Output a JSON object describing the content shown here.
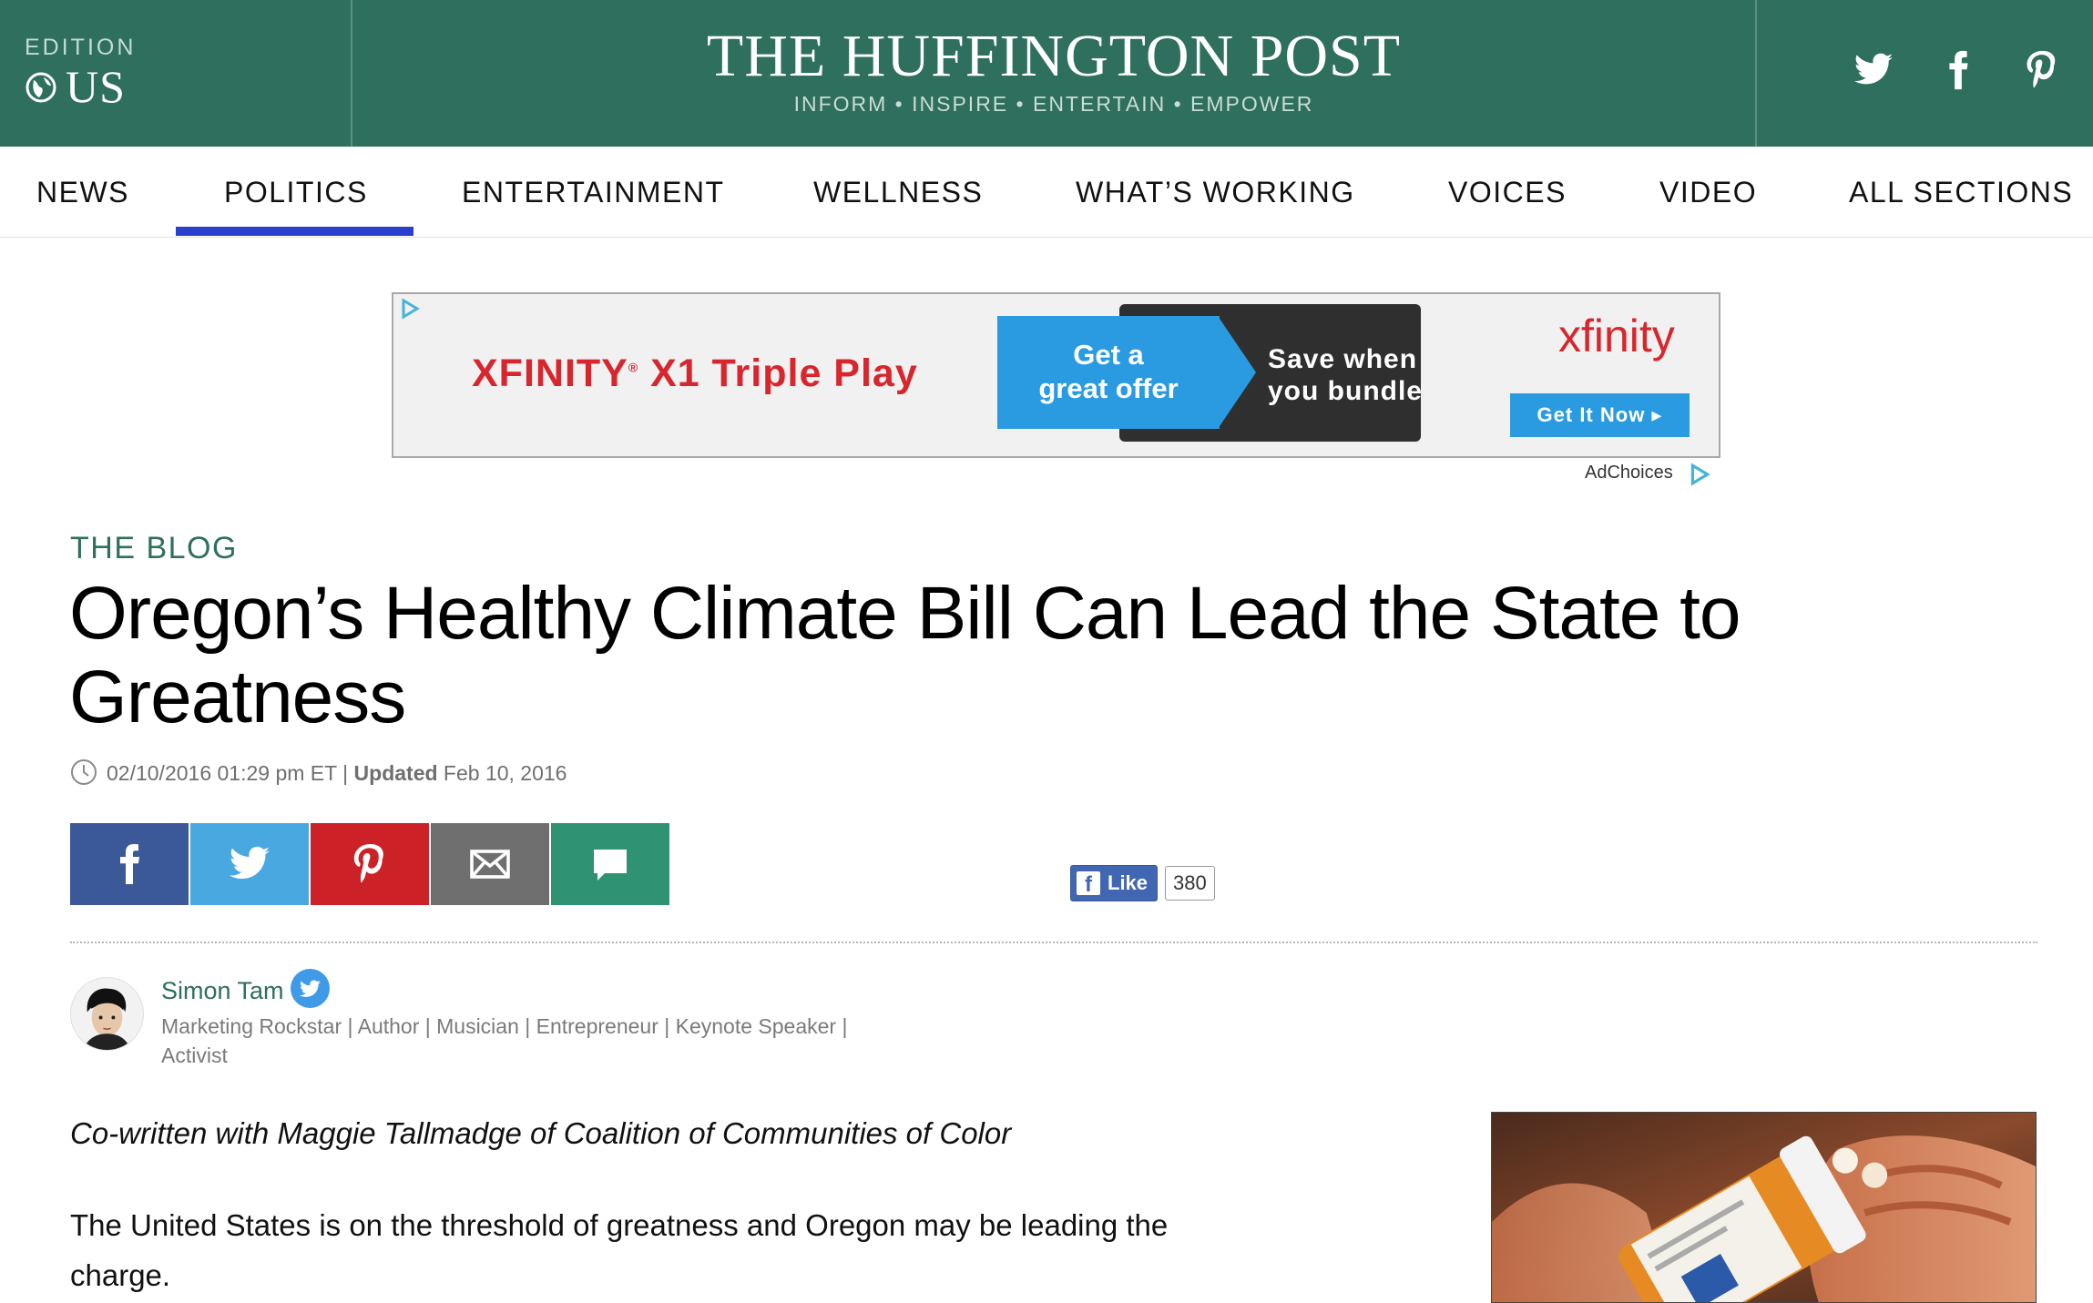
{
  "masthead": {
    "edition_label": "EDITION",
    "edition_value": "US",
    "logo": "THE HUFFINGTON POST",
    "tagline": "INFORM • INSPIRE • ENTERTAIN • EMPOWER",
    "background": "#2e6f5d"
  },
  "nav": {
    "items": [
      "NEWS",
      "POLITICS",
      "ENTERTAINMENT",
      "WELLNESS",
      "WHAT’S WORKING",
      "VOICES",
      "VIDEO",
      "ALL SECTIONS"
    ],
    "active": "POLITICS",
    "active_color": "#2a3fcb"
  },
  "ad": {
    "headline_brand": "XFINITY",
    "headline_mark": "®",
    "headline_product": " X1 Triple Play",
    "offer_line1": "Get a",
    "offer_line2": "great offer",
    "bundle_line1": "Save when",
    "bundle_line2": "you bundle",
    "brand": "xfinity",
    "cta": "Get It Now ▸",
    "adchoices": "AdChoices"
  },
  "article": {
    "section": "THE BLOG",
    "headline": "Oregon’s Healthy Climate Bill Can Lead the State to Greatness",
    "published": "02/10/2016 01:29 pm ET",
    "separator": "|",
    "updated_label": "Updated",
    "updated_date": "Feb 10, 2016",
    "like_label": "Like",
    "like_count": "380",
    "cowritten": "Co-written with Maggie Tallmadge of Coalition of Communities of Color",
    "paragraph": "The United States is on the threshold of greatness and Oregon may be leading the charge."
  },
  "author": {
    "name": "Simon Tam",
    "bio": "Marketing Rockstar | Author | Musician | Entrepreneur | Keynote Speaker | Activist"
  },
  "share": {
    "buttons": [
      {
        "name": "facebook",
        "color": "#3b5998"
      },
      {
        "name": "twitter",
        "color": "#4aa8e0"
      },
      {
        "name": "pinterest",
        "color": "#cc2127"
      },
      {
        "name": "email",
        "color": "#6f6f6f"
      },
      {
        "name": "comment",
        "color": "#2e9273"
      }
    ]
  }
}
